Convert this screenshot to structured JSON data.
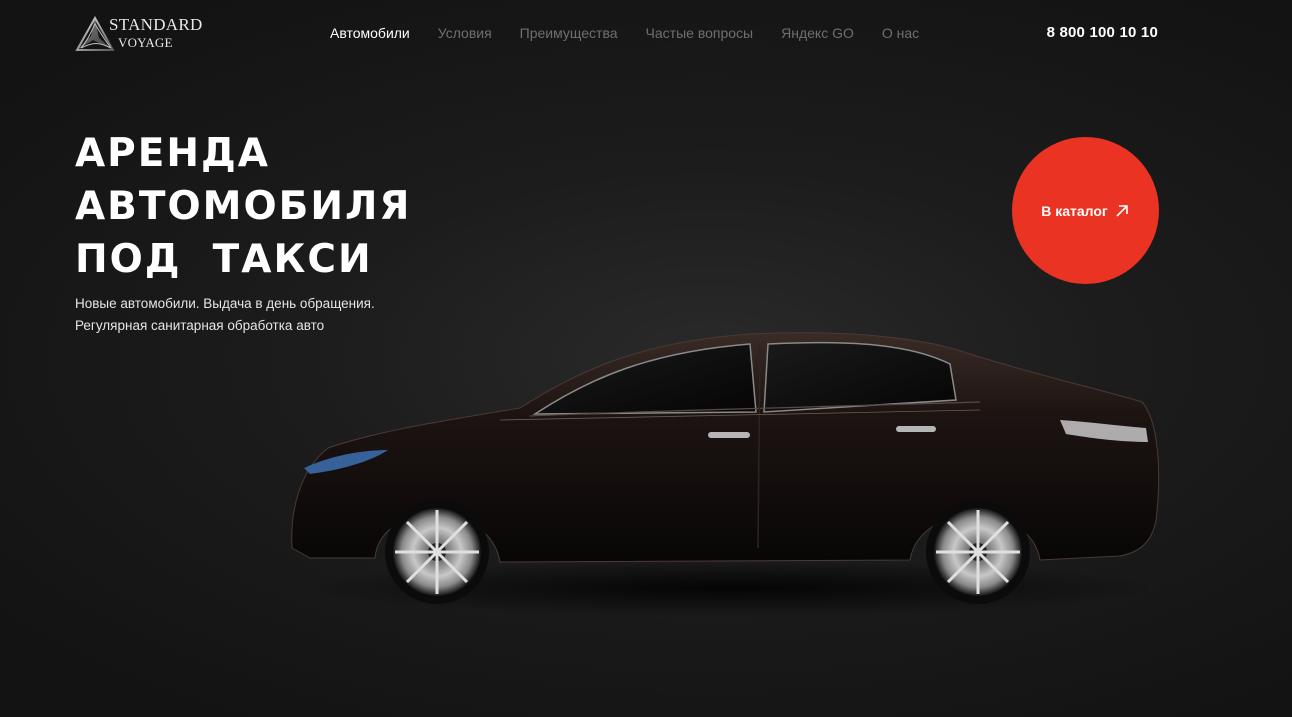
{
  "header": {
    "logo": {
      "line1": "STANDARD",
      "line2": "VOYAGE",
      "icon": "logo-triangle-icon"
    },
    "nav": [
      {
        "label": "Автомобили",
        "active": true
      },
      {
        "label": "Условия",
        "active": false
      },
      {
        "label": "Преимущества",
        "active": false
      },
      {
        "label": "Частые вопросы",
        "active": false
      },
      {
        "label": "Яндекс GO",
        "active": false
      },
      {
        "label": "О нас",
        "active": false
      }
    ],
    "phone": "8 800 100 10 10"
  },
  "hero": {
    "title_lines": [
      "АРЕНДА",
      "АВТОМОБИЛЯ",
      "ПОД  ТАКСИ"
    ],
    "subtitle_lines": [
      "Новые автомобили. Выдача в день обращения.",
      "Регулярная санитарная обработка авто"
    ],
    "cta": {
      "label": "В каталог",
      "icon": "arrow-up-right-icon",
      "color": "#ea3323"
    },
    "image": "black-sedan-car-image"
  },
  "colors": {
    "background": "#1c1c1c",
    "accent": "#ea3323",
    "nav_inactive": "#6f6f6f",
    "text": "#ffffff"
  }
}
